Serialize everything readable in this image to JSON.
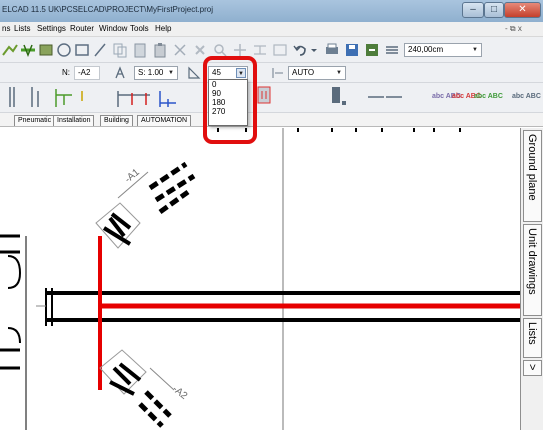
{
  "window": {
    "title": "ELCAD 11.5 UK\\PCSELCAD\\PROJECT\\MyFirstProject.proj",
    "min_glyph": "–",
    "max_glyph": "□",
    "close_glyph": "✕"
  },
  "menu": {
    "items": [
      "ns",
      "Lists",
      "Settings",
      "Router",
      "Window",
      "Tools",
      "Help"
    ],
    "mdi_controls": "- ⧉ x"
  },
  "toolbar1": {
    "length_value": "240,00cm"
  },
  "toolbar2": {
    "n_label": "N:",
    "n_value": "-A2",
    "s_label": "S: 1.00",
    "angle_value": "45",
    "mode_value": "AUTO"
  },
  "angle_dropdown": {
    "options": [
      "0",
      "90",
      "180",
      "270"
    ]
  },
  "text_styles": [
    "abc ABC",
    "abc ABC",
    "abc ABC",
    "abc ABC"
  ],
  "project_tabs": [
    "Pneumatic",
    "Installation",
    "Building",
    "AUTOMATION"
  ],
  "side_tabs": [
    "Ground plane",
    "Unit drawings",
    "Lists",
    ">"
  ],
  "drawing": {
    "labels": [
      "-A1",
      "-A2"
    ]
  },
  "colors": {
    "highlight": "#e10e0e",
    "wire": "#e60000",
    "line": "#000000"
  }
}
